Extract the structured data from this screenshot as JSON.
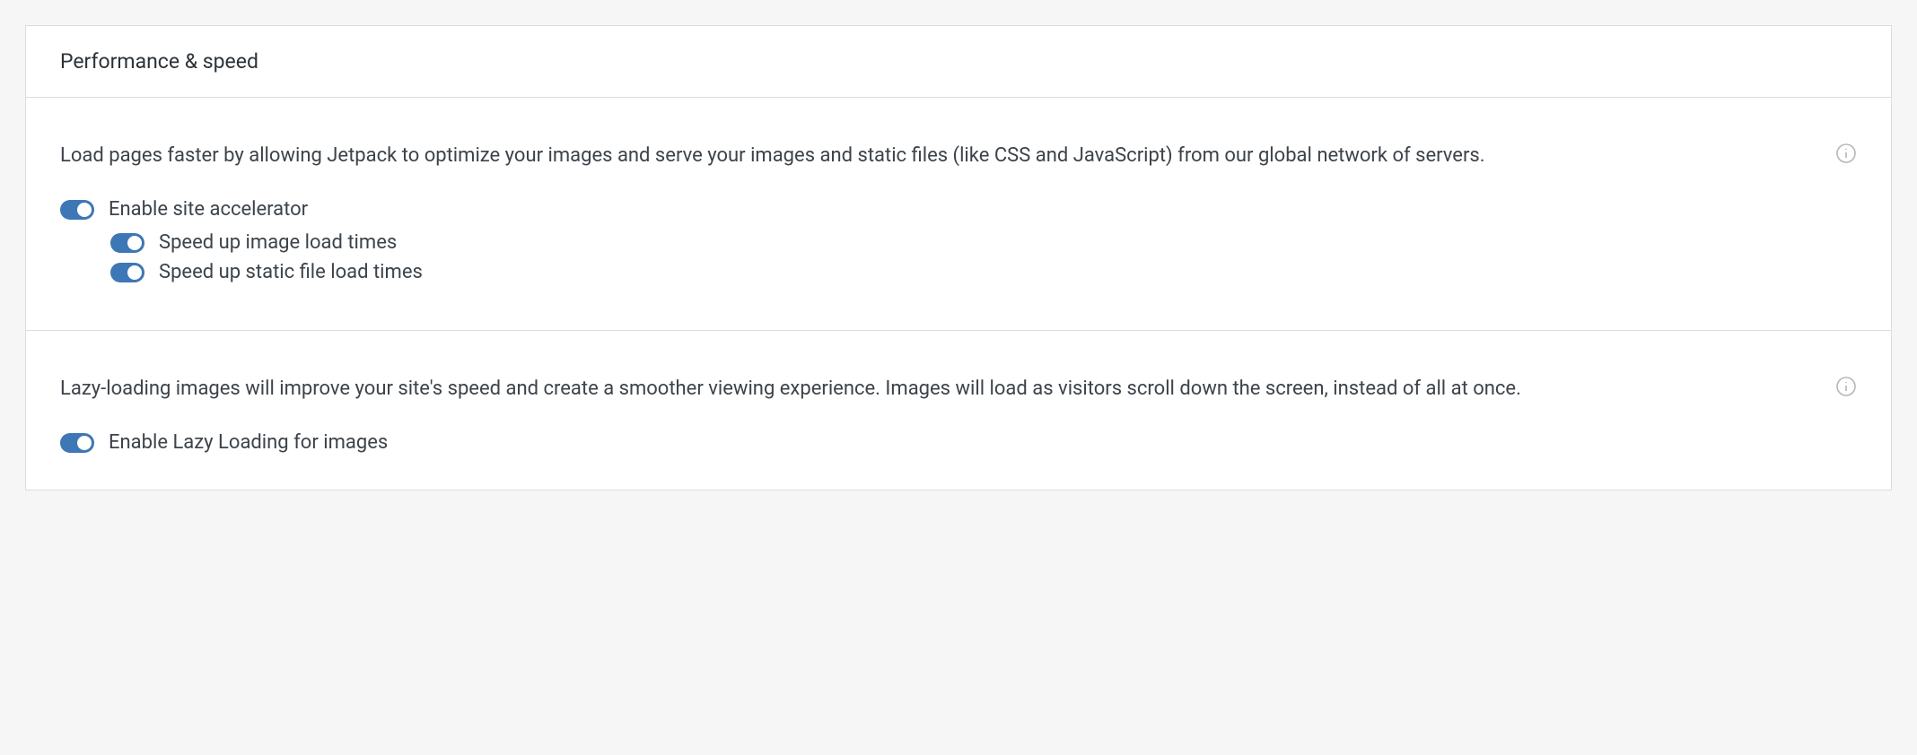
{
  "header": {
    "title": "Performance & speed"
  },
  "sections": {
    "accelerator": {
      "description": "Load pages faster by allowing Jetpack to optimize your images and serve your images and static files (like CSS and JavaScript) from our global network of servers.",
      "main_toggle_label": "Enable site accelerator",
      "sub_toggle_1_label": "Speed up image load times",
      "sub_toggle_2_label": "Speed up static file load times"
    },
    "lazy": {
      "description": "Lazy-loading images will improve your site's speed and create a smoother viewing experience. Images will load as visitors scroll down the screen, instead of all at once.",
      "main_toggle_label": "Enable Lazy Loading for images"
    }
  }
}
